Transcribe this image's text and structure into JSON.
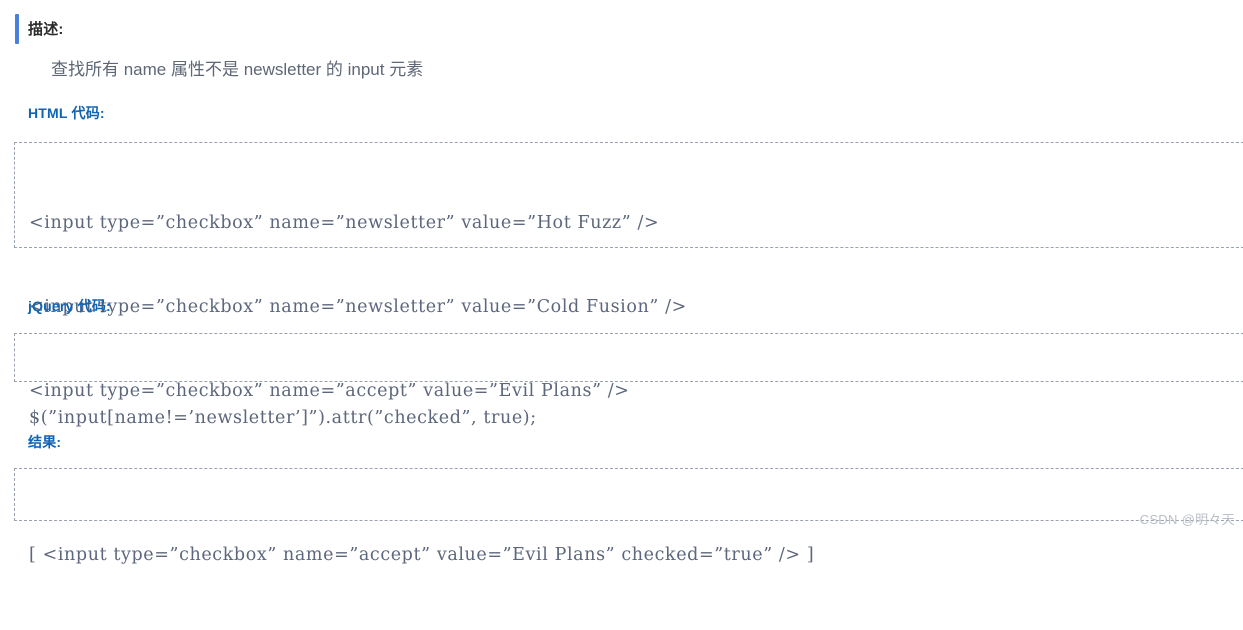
{
  "description": {
    "heading": "描述:",
    "text": "查找所有 name 属性不是 newsletter 的 input 元素"
  },
  "html_section": {
    "heading": "HTML 代码:",
    "lines": [
      "<input type=”checkbox” name=”newsletter” value=”Hot Fuzz” />",
      "<input type=”checkbox” name=”newsletter” value=”Cold Fusion” />",
      "<input type=”checkbox” name=”accept” value=”Evil Plans” />"
    ]
  },
  "jquery_section": {
    "heading": "jQuery 代码:",
    "lines": [
      "$(”input[name!=’newsletter’]”).attr(”checked”, true);"
    ]
  },
  "result_section": {
    "heading": "结果:",
    "lines": [
      "[ <input type=”checkbox” name=”accept” value=”Evil Plans” checked=”true” /> ]"
    ]
  },
  "watermark": {
    "text": "CSDN @明々天"
  },
  "colors": {
    "accent_bar": "#4a7fdb",
    "section_heading": "#1263b0",
    "description_text": "#5d6775",
    "code_text": "#5c667c",
    "box_border": "#9aa2ad",
    "watermark": "#b9bfc8",
    "background": "#ffffff"
  }
}
